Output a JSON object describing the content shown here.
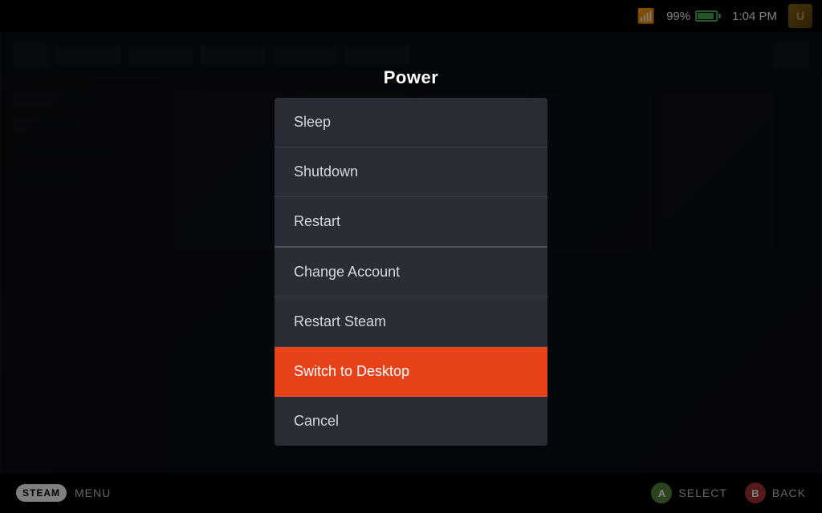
{
  "statusBar": {
    "wifiIcon": "📶",
    "batteryPercent": "99%",
    "time": "1:04 PM",
    "avatarLabel": "U"
  },
  "dialog": {
    "title": "Power",
    "items": [
      {
        "id": "sleep",
        "label": "Sleep",
        "active": false
      },
      {
        "id": "shutdown",
        "label": "Shutdown",
        "active": false
      },
      {
        "id": "restart",
        "label": "Restart",
        "active": false
      },
      {
        "id": "change-account",
        "label": "Change Account",
        "active": false
      },
      {
        "id": "restart-steam",
        "label": "Restart Steam",
        "active": false
      },
      {
        "id": "switch-desktop",
        "label": "Switch to Desktop",
        "active": true
      },
      {
        "id": "cancel",
        "label": "Cancel",
        "active": false
      }
    ]
  },
  "bottomBar": {
    "steamLabel": "STEAM",
    "menuLabel": "MENU",
    "selectLabel": "SELECT",
    "backLabel": "BACK",
    "selectBtn": "A",
    "backBtn": "B"
  }
}
